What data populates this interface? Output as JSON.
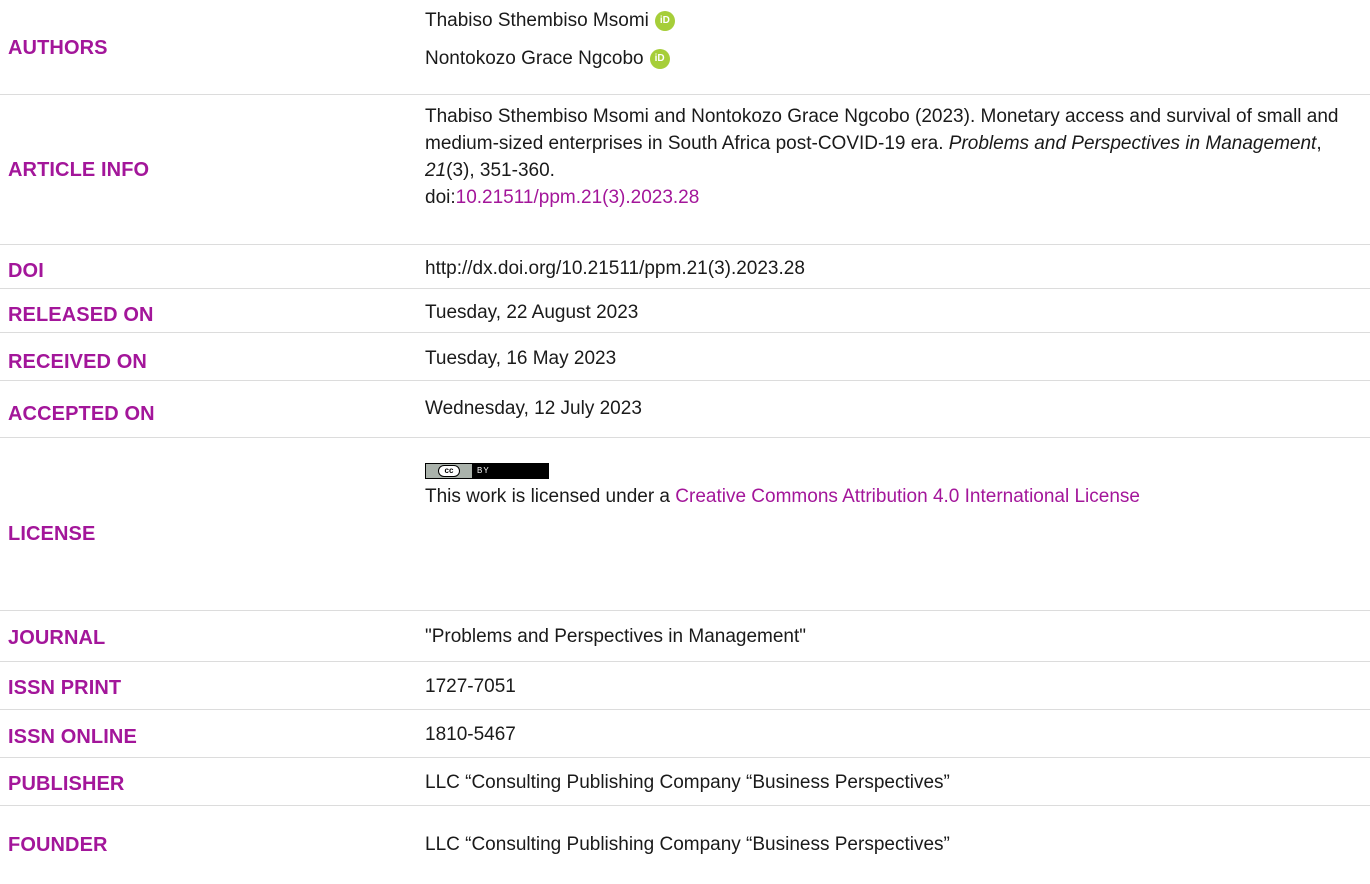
{
  "authors": {
    "label": "AUTHORS",
    "names": [
      "Thabiso Sthembiso Msomi",
      "Nontokozo Grace Ngcobo"
    ]
  },
  "article_info": {
    "label": "ARTICLE INFO",
    "citation_text": "Thabiso Sthembiso Msomi and Nontokozo Grace Ngcobo (2023). Monetary access and survival of small and medium-sized enterprises in South Africa post-COVID-19 era. ",
    "journal_italic": "Problems and Perspectives in Management",
    "sep1": ", ",
    "volume_italic": "21",
    "issue_pages": "(3), 351-360.",
    "doi_prefix": "doi:",
    "doi_link": "10.21511/ppm.21(3).2023.28"
  },
  "doi": {
    "label": "DOI",
    "value": "http://dx.doi.org/10.21511/ppm.21(3).2023.28"
  },
  "released_on": {
    "label": "RELEASED ON",
    "value": "Tuesday, 22 August 2023"
  },
  "received_on": {
    "label": "RECEIVED ON",
    "value": "Tuesday, 16 May 2023"
  },
  "accepted_on": {
    "label": "ACCEPTED ON",
    "value": "Wednesday, 12 July 2023"
  },
  "license": {
    "label": "LICENSE",
    "badge_left": "cc",
    "badge_right": "BY",
    "text_prefix": "This work is licensed under a ",
    "link_text": "Creative Commons Attribution 4.0 International License"
  },
  "journal": {
    "label": "JOURNAL",
    "value": "\"Problems and Perspectives in Management\""
  },
  "issn_print": {
    "label": "ISSN PRINT",
    "value": "1727-7051"
  },
  "issn_online": {
    "label": "ISSN ONLINE",
    "value": "1810-5467"
  },
  "publisher": {
    "label": "PUBLISHER",
    "value": "LLC “Consulting Publishing Company “Business Perspectives”"
  },
  "founder": {
    "label": "FOUNDER",
    "value": "LLC “Consulting Publishing Company “Business Perspectives”"
  },
  "colors": {
    "label_accent": "#a3169a",
    "orcid_green": "#a6ce39",
    "divider": "#dcdcdc"
  },
  "icons": {
    "orcid": "orcid-icon",
    "license_badge": "cc-by-badge"
  }
}
